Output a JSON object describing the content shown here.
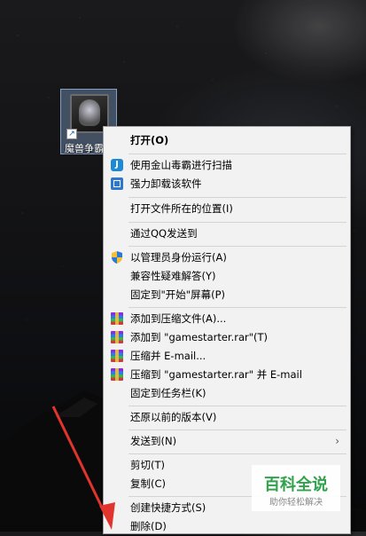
{
  "desktop": {
    "icon_label": "魔兽争霸"
  },
  "context_menu": {
    "items": [
      {
        "label": "打开(O)",
        "icon": "none",
        "bold": true
      },
      {
        "label": "使用金山毒霸进行扫描",
        "icon": "jinshan-antivirus-icon"
      },
      {
        "label": "强力卸载该软件",
        "icon": "uninstall-icon"
      },
      {
        "label": "打开文件所在的位置(I)",
        "icon": "none"
      },
      {
        "label": "通过QQ发送到",
        "icon": "none"
      },
      {
        "label": "以管理员身份运行(A)",
        "icon": "uac-shield-icon"
      },
      {
        "label": "兼容性疑难解答(Y)",
        "icon": "none"
      },
      {
        "label": "固定到\"开始\"屏幕(P)",
        "icon": "none"
      },
      {
        "label": "添加到压缩文件(A)...",
        "icon": "winrar-icon"
      },
      {
        "label": "添加到 \"gamestarter.rar\"(T)",
        "icon": "winrar-icon"
      },
      {
        "label": "压缩并 E-mail...",
        "icon": "winrar-icon"
      },
      {
        "label": "压缩到 \"gamestarter.rar\" 并 E-mail",
        "icon": "winrar-icon"
      },
      {
        "label": "固定到任务栏(K)",
        "icon": "none"
      },
      {
        "label": "还原以前的版本(V)",
        "icon": "none"
      },
      {
        "label": "发送到(N)",
        "icon": "none",
        "submenu": true
      },
      {
        "label": "剪切(T)",
        "icon": "none"
      },
      {
        "label": "复制(C)",
        "icon": "none"
      },
      {
        "label": "创建快捷方式(S)",
        "icon": "none"
      },
      {
        "label": "删除(D)",
        "icon": "none"
      }
    ]
  },
  "watermark": {
    "title": "百科全说",
    "subtitle": "助你轻松解决"
  },
  "colors": {
    "menu_bg": "#f2f2f2",
    "annotation_arrow": "#e0342c",
    "watermark_green": "#2fa24b"
  }
}
